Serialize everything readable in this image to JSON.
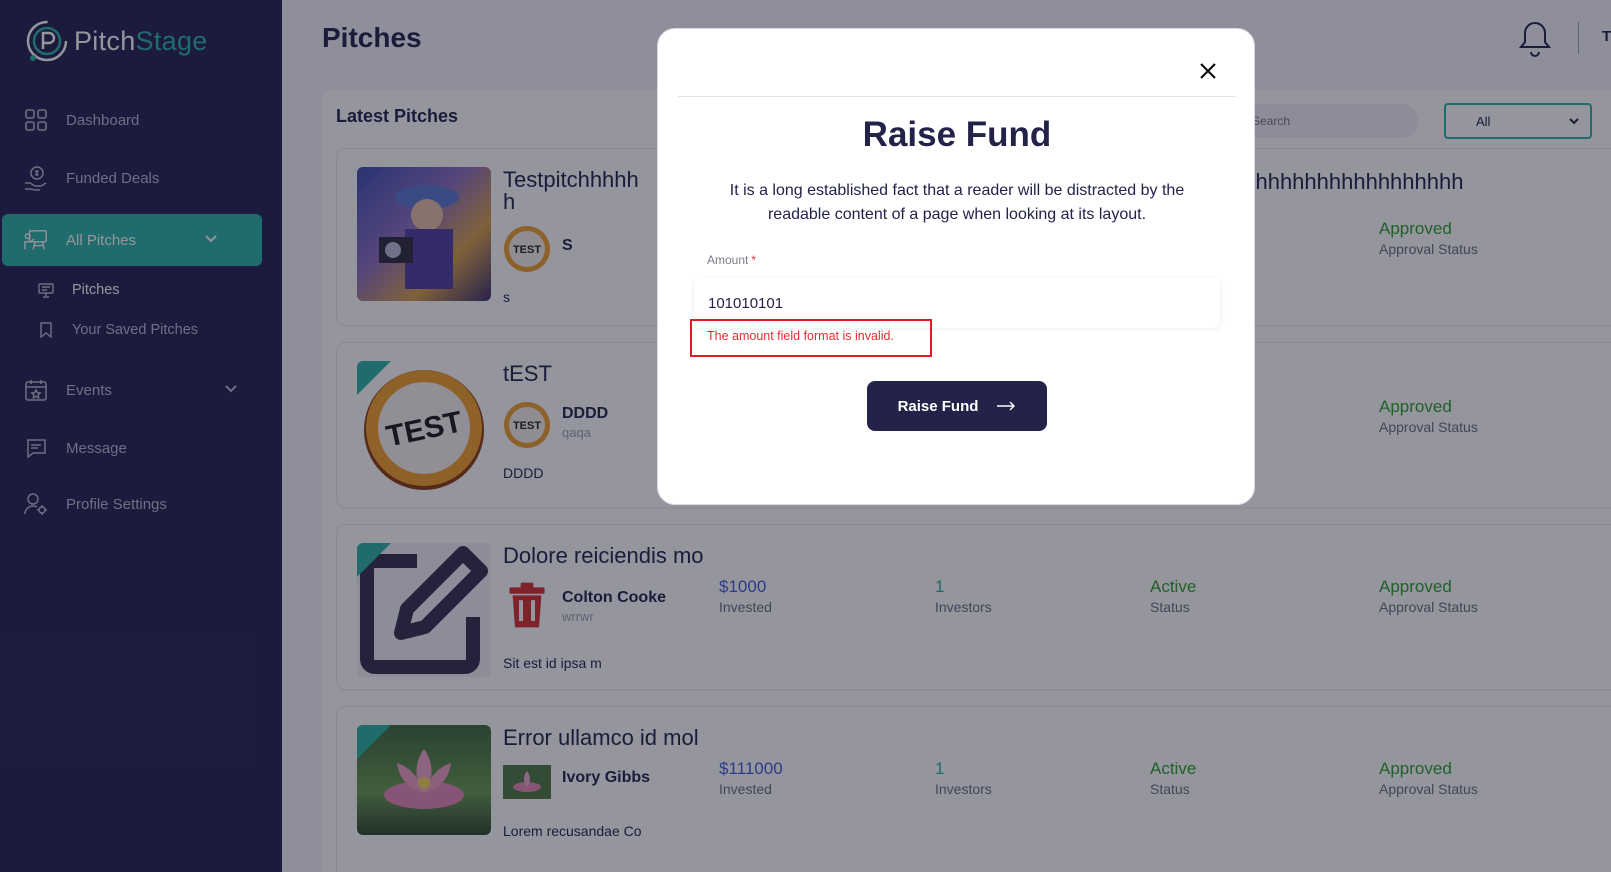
{
  "app": {
    "logo_text_part1": "Pitch",
    "logo_text_part2": "Stage"
  },
  "sidebar": {
    "items": [
      {
        "label": "Dashboard",
        "icon": "grid-icon"
      },
      {
        "label": "Funded Deals",
        "icon": "money-hand-icon"
      },
      {
        "label": "All Pitches",
        "icon": "presentation-icon",
        "active": true
      },
      {
        "label": "Events",
        "icon": "calendar-icon"
      },
      {
        "label": "Message",
        "icon": "chat-icon"
      },
      {
        "label": "Profile Settings",
        "icon": "user-settings-icon"
      }
    ],
    "sub_items": [
      {
        "label": "Pitches",
        "icon": "board-icon"
      },
      {
        "label": "Your Saved Pitches",
        "icon": "bookmark-icon"
      }
    ]
  },
  "header": {
    "title": "Pitches",
    "user_initial": "T"
  },
  "panel": {
    "title": "Latest Pitches",
    "search_placeholder": "Search",
    "filter_value": "All"
  },
  "pitches": [
    {
      "title": "Testpitchhhhhhhhhhhhhhhhhhhhhhhhhhhhhhhhhhhhhhhhhhhhhhhhhhhhhhhhhh h",
      "title_line1": "Testpitchhhhh",
      "title_line2": "h",
      "title_tail": "hhhhhhhhhhhhhhhhhhh",
      "owner": "S",
      "description": "s",
      "approval": "Approved",
      "approval_label": "Approval Status"
    },
    {
      "title": "tEST",
      "owner": "DDDD",
      "owner_sub": "qaqa",
      "description": "DDDD",
      "approval": "Approved",
      "approval_label": "Approval Status"
    },
    {
      "title": "Dolore reiciendis mo",
      "owner": "Colton Cooke",
      "owner_sub": "wrrwr",
      "description": "Sit est id ipsa m",
      "invested": "$1000",
      "invested_label": "Invested",
      "investors": "1",
      "investors_label": "Investors",
      "status": "Active",
      "status_label": "Status",
      "approval": "Approved",
      "approval_label": "Approval Status"
    },
    {
      "title": "Error ullamco id mol",
      "owner": "Ivory Gibbs",
      "description": "Lorem recusandae Co",
      "invested": "$111000",
      "invested_label": "Invested",
      "investors": "1",
      "investors_label": "Investors",
      "status": "Active",
      "status_label": "Status",
      "approval": "Approved",
      "approval_label": "Approval Status"
    }
  ],
  "modal": {
    "title": "Raise Fund",
    "description": "It is a long established fact that a reader will be distracted by the readable content of a page when looking at its layout.",
    "amount_label": "Amount",
    "required_mark": "*",
    "amount_value": "101010101",
    "error": "The amount field format is invalid.",
    "submit_label": "Raise Fund"
  },
  "colors": {
    "sidebar_bg": "#232250",
    "accent": "#2bb3a2",
    "primary_dark": "#23234a",
    "error": "#e0312f",
    "approved": "#2aa02a",
    "invested": "#3f5bd6"
  }
}
